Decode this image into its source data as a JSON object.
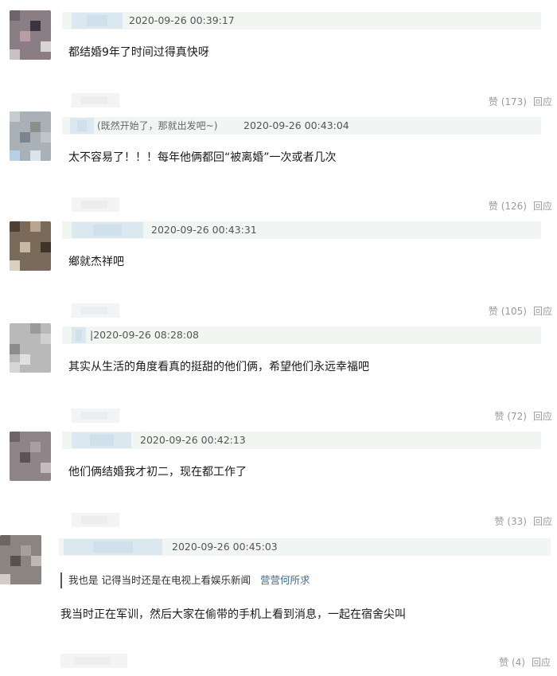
{
  "comments": [
    {
      "user_extra": "",
      "time": "2020-09-26 00:39:17",
      "content": "都结婚9年了时间过得真快呀",
      "like_label": "赞",
      "like_count": "(173)",
      "reply_label": "回应"
    },
    {
      "user_extra": "(既然开始了，那就出发吧~)",
      "time": "2020-09-26 00:43:04",
      "content": "太不容易了！！！每年他俩都回“被离婚”一次或者几次",
      "like_label": "赞",
      "like_count": "(126)",
      "reply_label": "回应"
    },
    {
      "user_extra": "",
      "time": "2020-09-26 00:43:31",
      "content": "鄉就杰祥吧",
      "like_label": "赞",
      "like_count": "(105)",
      "reply_label": "回应"
    },
    {
      "user_extra": "",
      "time": "|2020-09-26 08:28:08",
      "content": "其实从生活的角度看真的挺甜的他们俩，希望他们永远幸福吧",
      "like_label": "赞",
      "like_count": "(72)",
      "reply_label": "回应"
    },
    {
      "user_extra": "",
      "time": "2020-09-26 00:42:13",
      "content": "他们俩结婚我才初二，现在都工作了",
      "like_label": "赞",
      "like_count": "(33)",
      "reply_label": "回应"
    },
    {
      "user_extra": "",
      "time": "2020-09-26 00:45:03",
      "quote_text": "我也是 记得当时还是在电视上看娱乐新闻",
      "quote_user": "营营何所求",
      "content": "我当时正在军训，然后大家在偷带的手机上看到消息，一起在宿舍尖叫",
      "like_label": "赞",
      "like_count": "(4)",
      "reply_label": "回应"
    }
  ]
}
